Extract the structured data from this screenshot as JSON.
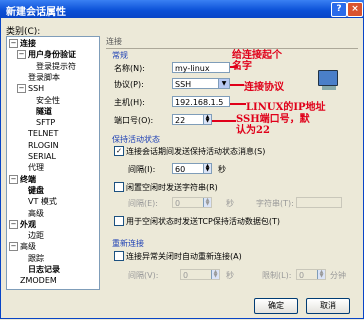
{
  "window": {
    "title": "新建会话属性",
    "help_btn": "?",
    "close_btn": "×"
  },
  "category_label": "类别(C):",
  "tree": [
    {
      "label": "连接",
      "bold": true,
      "expander": "−",
      "level": 0
    },
    {
      "label": "用户身份验证",
      "bold": true,
      "expander": "−",
      "level": 1
    },
    {
      "label": "登录提示符",
      "level": 2
    },
    {
      "label": "登录脚本",
      "level": 1
    },
    {
      "label": "SSH",
      "expander": "−",
      "level": 1
    },
    {
      "label": "安全性",
      "level": 2
    },
    {
      "label": "隧道",
      "bold": true,
      "level": 2
    },
    {
      "label": "SFTP",
      "level": 2
    },
    {
      "label": "TELNET",
      "level": 1
    },
    {
      "label": "RLOGIN",
      "level": 1
    },
    {
      "label": "SERIAL",
      "level": 1
    },
    {
      "label": "代理",
      "level": 1
    },
    {
      "label": "终端",
      "bold": true,
      "expander": "−",
      "level": 0
    },
    {
      "label": "键盘",
      "bold": true,
      "level": 1
    },
    {
      "label": "VT 模式",
      "level": 1
    },
    {
      "label": "高级",
      "level": 1
    },
    {
      "label": "外观",
      "bold": true,
      "expander": "−",
      "level": 0
    },
    {
      "label": "边距",
      "level": 1
    },
    {
      "label": "高级",
      "expander": "−",
      "level": 0
    },
    {
      "label": "跟踪",
      "level": 1
    },
    {
      "label": "日志记录",
      "bold": true,
      "level": 1
    },
    {
      "label": "ZMODEM",
      "level": 0
    }
  ],
  "pane_header": "连接",
  "general": {
    "title": "常规",
    "name_label": "名称(N):",
    "name_value": "my-linux",
    "protocol_label": "协议(P):",
    "protocol_value": "SSH",
    "host_label": "主机(H):",
    "host_value": "192.168.1.5",
    "port_label": "端口号(O):",
    "port_value": "22"
  },
  "keepalive": {
    "title": "保持活动状态",
    "send_keepalive": "连接会话期间发送保持活动状态消息(S)",
    "interval_label": "间隔(I):",
    "interval_value": "60",
    "sec": "秒",
    "idle_send": "闲置空闲时发送字符串(R)",
    "idle_interval_label": "间隔(E):",
    "idle_interval_value": "0",
    "sec2": "秒",
    "string_label": "字符串(T):",
    "tcp_keepalive": "用于空闲状态时发送TCP保持活动数据包(T)"
  },
  "reconnect": {
    "title": "重新连接",
    "auto_reconnect": "连接异常关闭时自动重新连接(A)",
    "interval_label": "间隔(V):",
    "interval_value": "0",
    "sec": "秒",
    "limit_label": "限制(L):",
    "limit_value": "0",
    "minute": "分钟"
  },
  "annotations": {
    "name": "给连接起个\n名字",
    "protocol": "连接协议",
    "host": "LINUX的IP地址",
    "port": "SSH端口号，默\n认为22"
  },
  "buttons": {
    "ok": "确定",
    "cancel": "取消"
  }
}
